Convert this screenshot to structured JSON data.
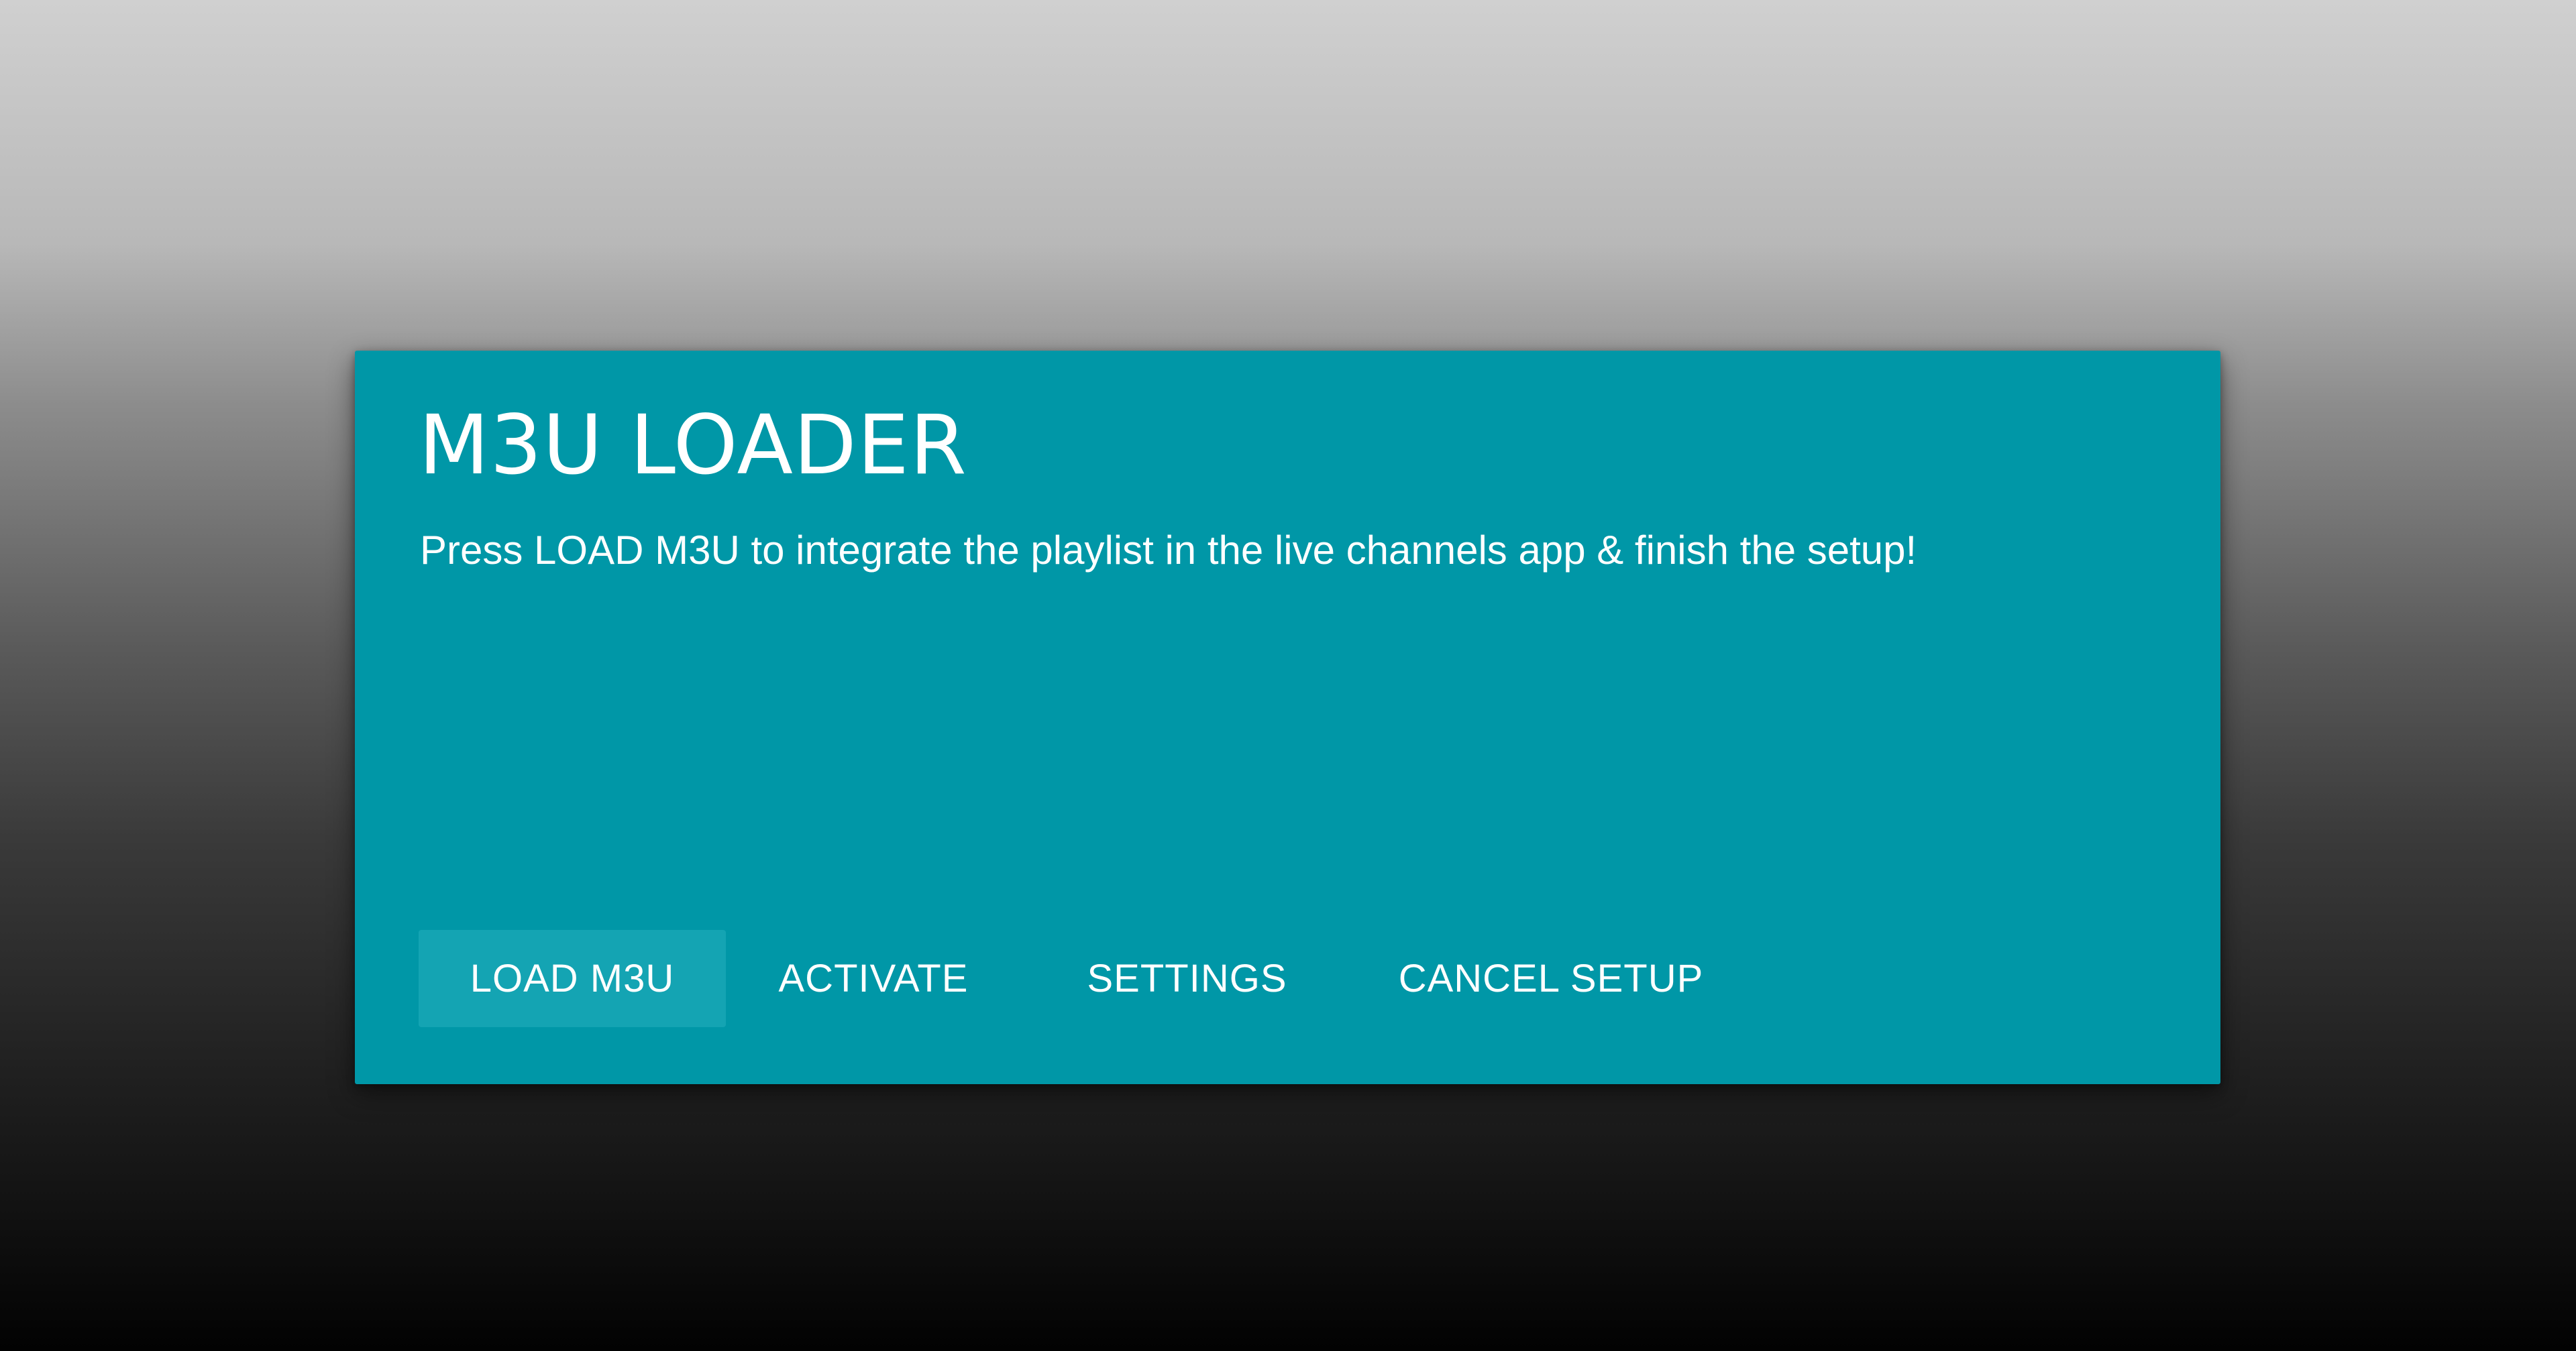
{
  "dialog": {
    "title": "M3U LOADER",
    "message": "Press LOAD M3U to integrate the playlist in the live channels app & finish the setup!",
    "background_color": "#0097a7",
    "focused_button_color": "#14a4b3",
    "buttons": [
      {
        "label": "LOAD M3U",
        "focused": true
      },
      {
        "label": "ACTIVATE",
        "focused": false
      },
      {
        "label": "SETTINGS",
        "focused": false
      },
      {
        "label": "CANCEL SETUP",
        "focused": false
      }
    ]
  }
}
